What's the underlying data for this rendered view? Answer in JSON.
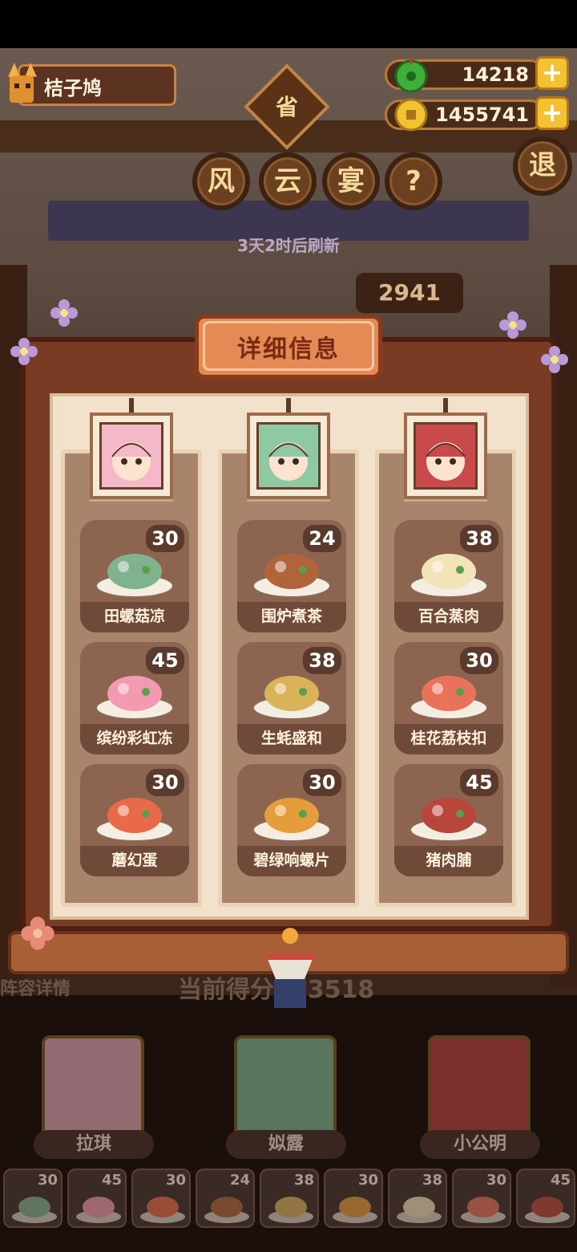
{
  "player": {
    "name": "桔子鸠"
  },
  "currency": {
    "jade": "14218",
    "coins": "1455741"
  },
  "header": {
    "emblem": "省",
    "title_chars": [
      "风",
      "云",
      "宴"
    ],
    "help_label": "?",
    "exit_label": "退",
    "refresh_text": "3天2时后刷新",
    "score_badge": "2941"
  },
  "panel": {
    "title": "详细信息",
    "columns": [
      {
        "character": "拉琪",
        "portrait_color": "#f4b8c8",
        "dishes": [
          {
            "name": "田螺菇凉",
            "value": "30",
            "color": "#7fb38e",
            "icon": "snail-mushroom-dish-icon"
          },
          {
            "name": "缤纷彩虹冻",
            "value": "45",
            "color": "#f29bb0",
            "icon": "rainbow-jelly-icon"
          },
          {
            "name": "蘑幻蛋",
            "value": "30",
            "color": "#e86a4a",
            "icon": "mushroom-egg-icon"
          }
        ]
      },
      {
        "character": "姒露",
        "portrait_color": "#8fc9a4",
        "dishes": [
          {
            "name": "围炉煮茶",
            "value": "24",
            "color": "#b0643a",
            "icon": "teapot-stove-icon"
          },
          {
            "name": "生蚝盛和",
            "value": "38",
            "color": "#d9b35a",
            "icon": "oyster-platter-icon"
          },
          {
            "name": "碧绿响螺片",
            "value": "30",
            "color": "#e59c3a",
            "icon": "conch-slices-icon"
          }
        ]
      },
      {
        "character": "小公明",
        "portrait_color": "#c94a4a",
        "dishes": [
          {
            "name": "百合蒸肉",
            "value": "38",
            "color": "#f1e4b8",
            "icon": "lily-steamed-pork-icon"
          },
          {
            "name": "桂花荔枝扣",
            "value": "30",
            "color": "#e8735a",
            "icon": "osmanthus-lychee-icon"
          },
          {
            "name": "猪肉脯",
            "value": "45",
            "color": "#b8463a",
            "icon": "pork-jerky-icon"
          }
        ]
      }
    ]
  },
  "bottom": {
    "score_label": "当前得分",
    "score_value": "723518",
    "lineup_label": "阵容详情",
    "characters": [
      "拉琪",
      "姒露",
      "小公明"
    ],
    "slots": [
      "30",
      "45",
      "30",
      "24",
      "38",
      "30",
      "38",
      "30",
      "45"
    ]
  }
}
